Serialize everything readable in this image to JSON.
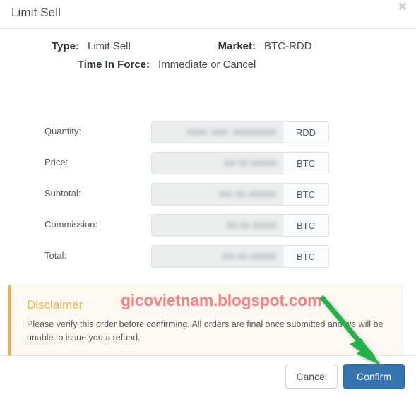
{
  "modal": {
    "title": "Limit Sell",
    "close_icon": "✖"
  },
  "summary": {
    "type_label": "Type:",
    "type_value": "Limit Sell",
    "market_label": "Market:",
    "market_value": "BTC-RDD",
    "tif_label": "Time In Force:",
    "tif_value": "Immediate or Cancel"
  },
  "fields": [
    {
      "label": "Quantity:",
      "value": "",
      "unit": "RDD"
    },
    {
      "label": "Price:",
      "value": "",
      "unit": "BTC"
    },
    {
      "label": "Subtotal:",
      "value": "",
      "unit": "BTC"
    },
    {
      "label": "Commission:",
      "value": "",
      "unit": "BTC"
    },
    {
      "label": "Total:",
      "value": "",
      "unit": "BTC"
    }
  ],
  "alert": {
    "title": "Disclaimer",
    "text": "Please verify this order before confirming. All orders are final once submitted and we will be unable to issue you a refund."
  },
  "watermark": {
    "text": "gicovietnam.blogspot.com"
  },
  "footer": {
    "cancel_label": "Cancel",
    "confirm_label": "Confirm"
  },
  "colors": {
    "primary_button": "#3573b0",
    "alert_border": "#f0ad4e",
    "alert_background": "#fdf8f1",
    "alert_title": "#f0b559",
    "watermark": "#fa8282",
    "annotation_arrow": "#22b14c",
    "input_disabled": "#eceded"
  },
  "annotation": {
    "arrow_name": "green-arrow-pointing-to-confirm"
  }
}
